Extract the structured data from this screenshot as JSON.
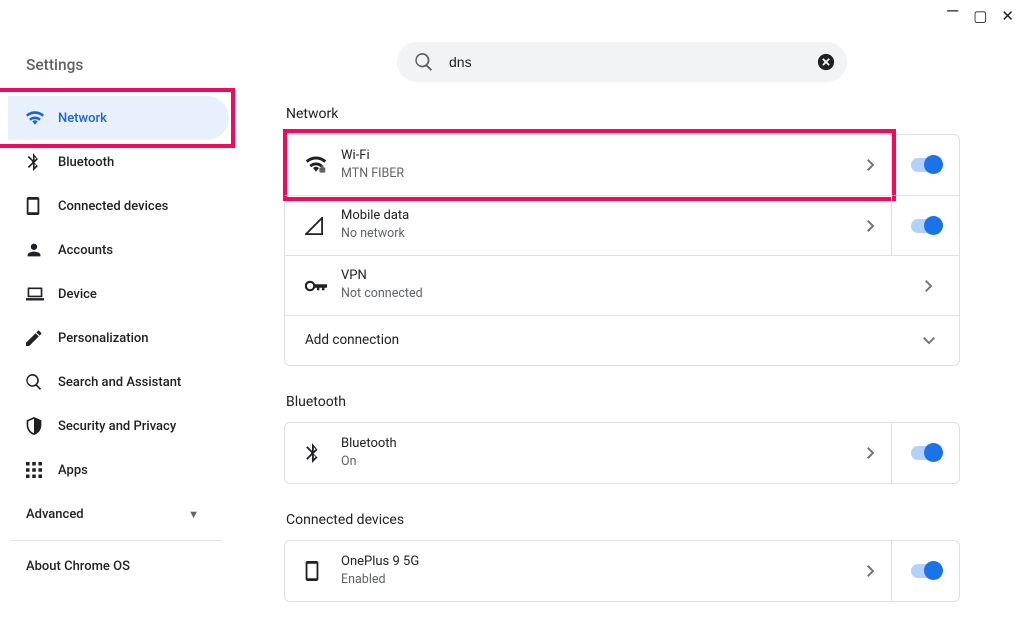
{
  "window": {
    "title": "Settings"
  },
  "sidebar": {
    "title": "Settings",
    "items": [
      {
        "label": "Network",
        "icon": "wifi",
        "active": true
      },
      {
        "label": "Bluetooth",
        "icon": "bluetooth"
      },
      {
        "label": "Connected devices",
        "icon": "device-rect"
      },
      {
        "label": "Accounts",
        "icon": "person"
      },
      {
        "label": "Device",
        "icon": "laptop"
      },
      {
        "label": "Personalization",
        "icon": "pencil"
      },
      {
        "label": "Search and Assistant",
        "icon": "search"
      },
      {
        "label": "Security and Privacy",
        "icon": "shield"
      },
      {
        "label": "Apps",
        "icon": "apps"
      }
    ],
    "advanced_label": "Advanced",
    "about_label": "About Chrome OS"
  },
  "search": {
    "value": "dns",
    "placeholder": "Search settings"
  },
  "sections": {
    "network": {
      "title": "Network",
      "rows": [
        {
          "key": "wifi",
          "title": "Wi-Fi",
          "sub": "MTN FIBER",
          "toggle": true
        },
        {
          "key": "mobile",
          "title": "Mobile data",
          "sub": "No network",
          "toggle": true
        },
        {
          "key": "vpn",
          "title": "VPN",
          "sub": "Not connected",
          "toggle": false
        }
      ],
      "add_label": "Add connection"
    },
    "bluetooth": {
      "title": "Bluetooth",
      "rows": [
        {
          "key": "bluetooth",
          "title": "Bluetooth",
          "sub": "On",
          "toggle": true
        }
      ]
    },
    "connected": {
      "title": "Connected devices",
      "rows": [
        {
          "key": "oneplus",
          "title": "OnePlus 9 5G",
          "sub": "Enabled",
          "toggle": true
        }
      ]
    }
  }
}
